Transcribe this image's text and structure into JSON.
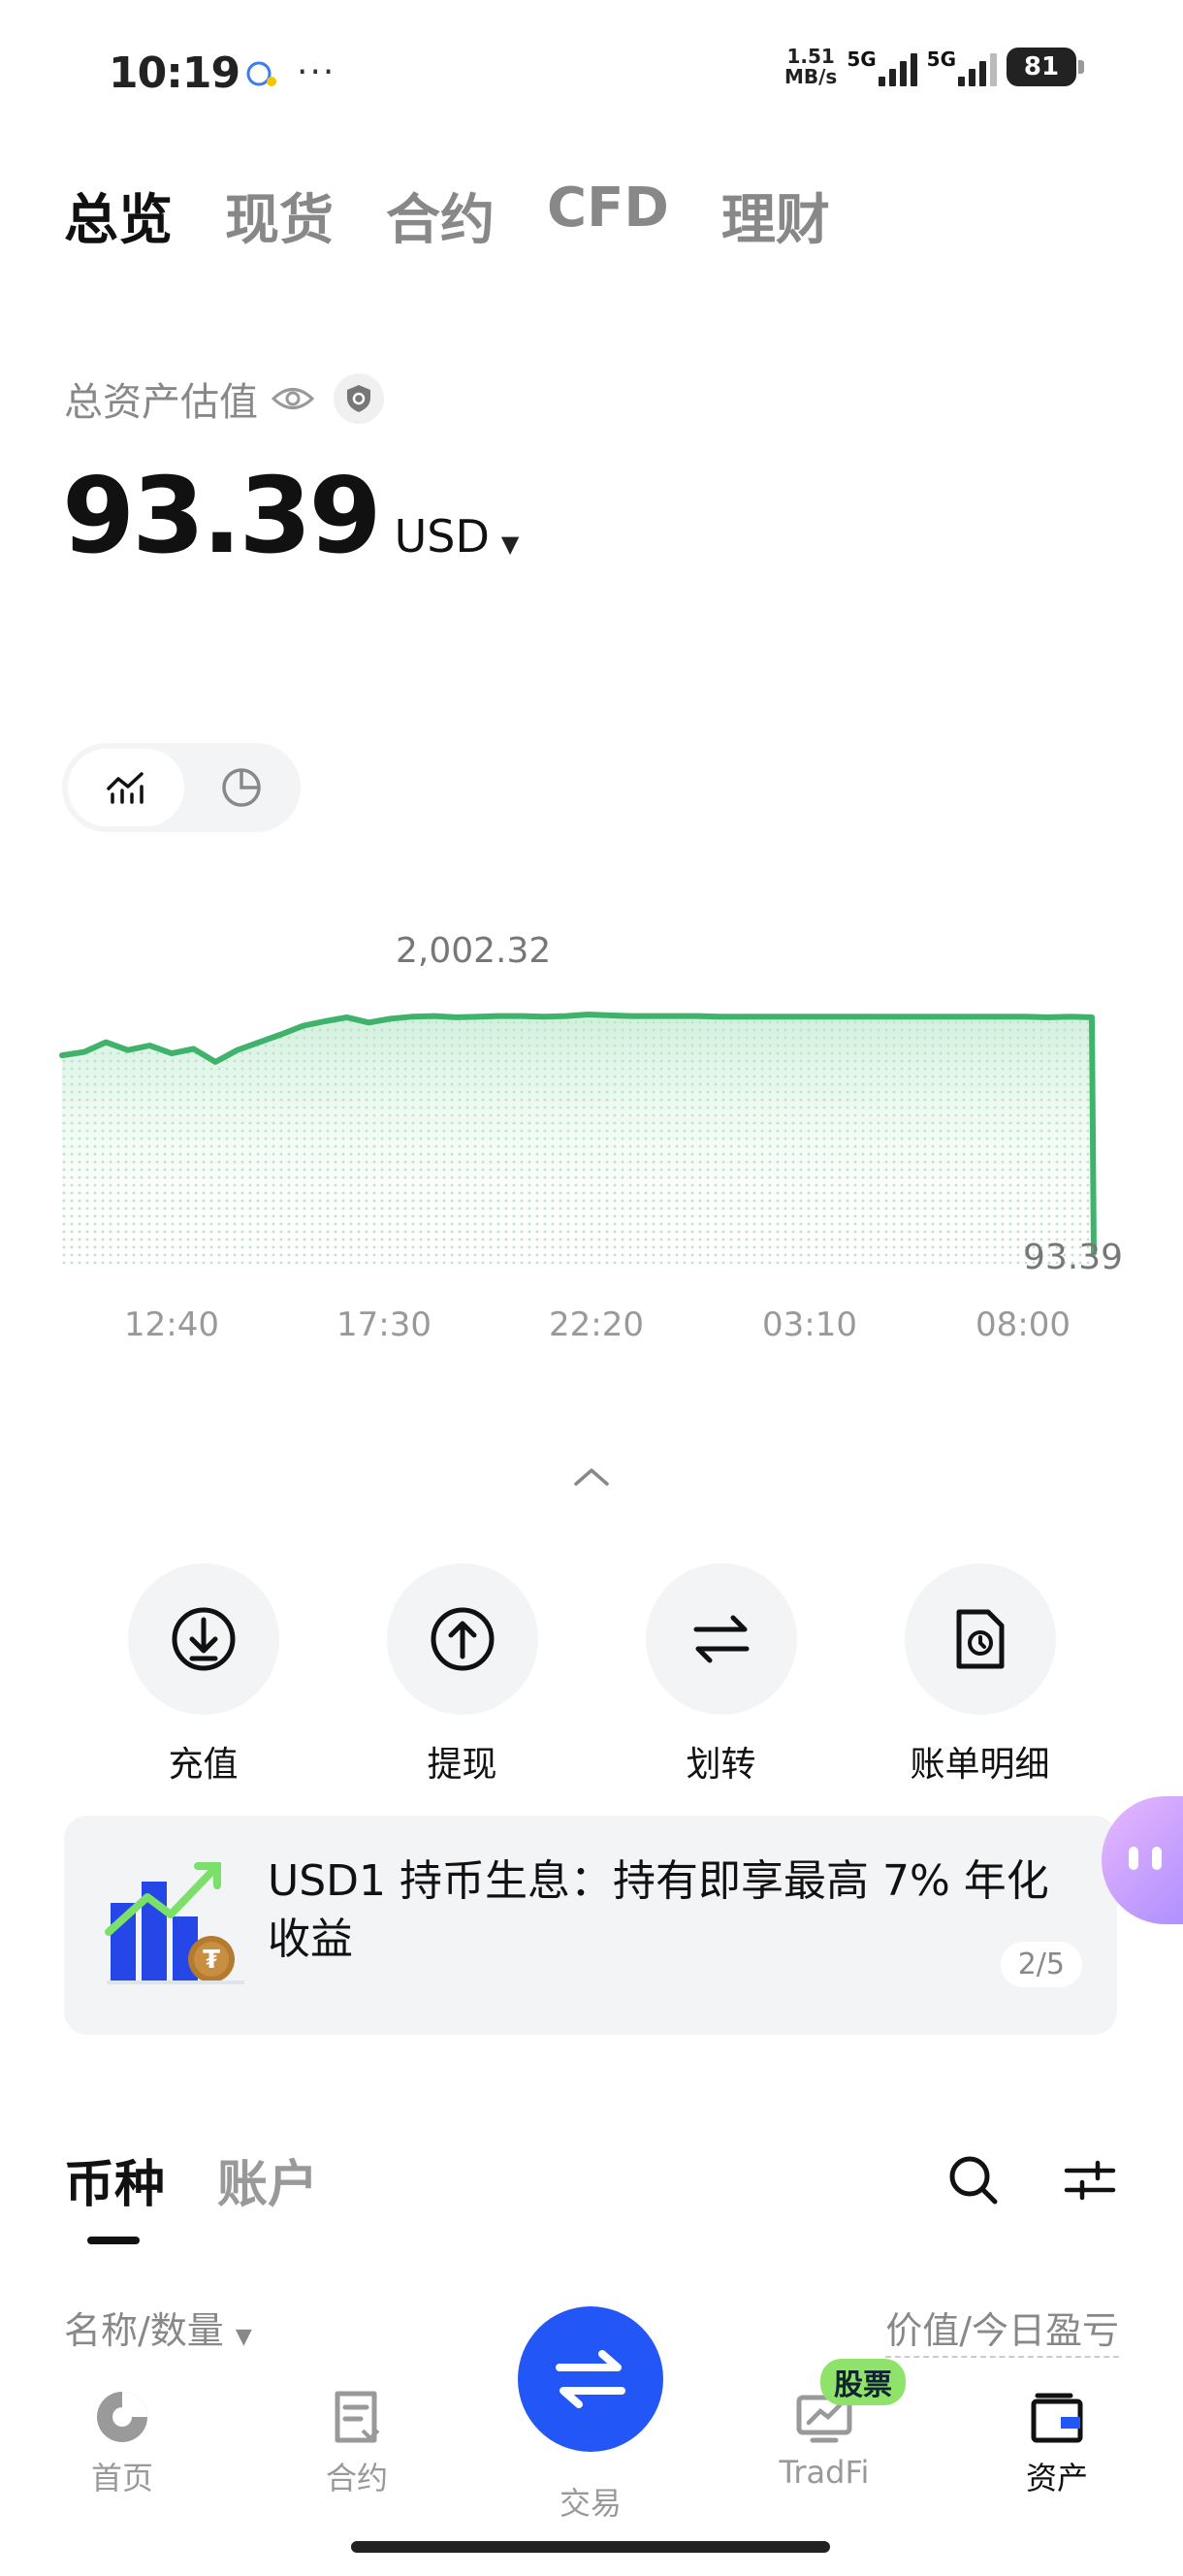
{
  "status_bar": {
    "time": "10:19",
    "dots": "···",
    "speed_line1": "1.51",
    "speed_line2": "MB/s",
    "network1": "5G",
    "network2": "5G",
    "battery": "81"
  },
  "top_tabs": [
    {
      "label": "总览",
      "active": true
    },
    {
      "label": "现货",
      "active": false
    },
    {
      "label": "合约",
      "active": false
    },
    {
      "label": "CFD",
      "active": false
    },
    {
      "label": "理财",
      "active": false
    }
  ],
  "asset": {
    "label": "总资产估值",
    "value": "93.39",
    "currency": "USD"
  },
  "chart_data": {
    "type": "line",
    "x_ticks": [
      "12:40",
      "17:30",
      "22:20",
      "03:10",
      "08:00"
    ],
    "peak_label": "2,002.32",
    "end_label": "93.39",
    "series": [
      {
        "values": [
          1940,
          1945,
          1960,
          1948,
          1955,
          1943,
          1950,
          1930,
          1948,
          1960,
          1972,
          1985,
          1992,
          1998,
          1990,
          1996,
          1999,
          2000,
          1998,
          1999,
          2000,
          2000,
          1999,
          2000,
          2002.32,
          2001,
          2000,
          2000,
          2000,
          2000,
          1999,
          1999,
          1999,
          1999,
          1999,
          1999,
          1999,
          1999,
          1999,
          1999,
          1999,
          1999,
          1999,
          1999,
          1999,
          1998,
          1999,
          1998,
          93.39
        ]
      }
    ],
    "color": "#3fb36b"
  },
  "chevron": "chevron-up",
  "actions": [
    {
      "label": "充值",
      "icon": "deposit-icon"
    },
    {
      "label": "提现",
      "icon": "withdraw-icon"
    },
    {
      "label": "划转",
      "icon": "transfer-icon"
    },
    {
      "label": "账单明细",
      "icon": "bill-icon"
    }
  ],
  "banner": {
    "text": "USD1 持币生息：持有即享最高 7% 年化收益",
    "pager": "2/5"
  },
  "list_tabs": [
    {
      "label": "币种",
      "active": true
    },
    {
      "label": "账户",
      "active": false
    }
  ],
  "columns": {
    "left": "名称/数量",
    "right": "价值/今日盈亏"
  },
  "bottom_nav": {
    "home": "首页",
    "contract": "合约",
    "trade": "交易",
    "tradfi": "TradFi",
    "tradfi_badge": "股票",
    "assets": "资产"
  },
  "colors": {
    "accent": "#2256f6",
    "chart_line": "#3fb36b",
    "badge": "#8fe36b"
  }
}
